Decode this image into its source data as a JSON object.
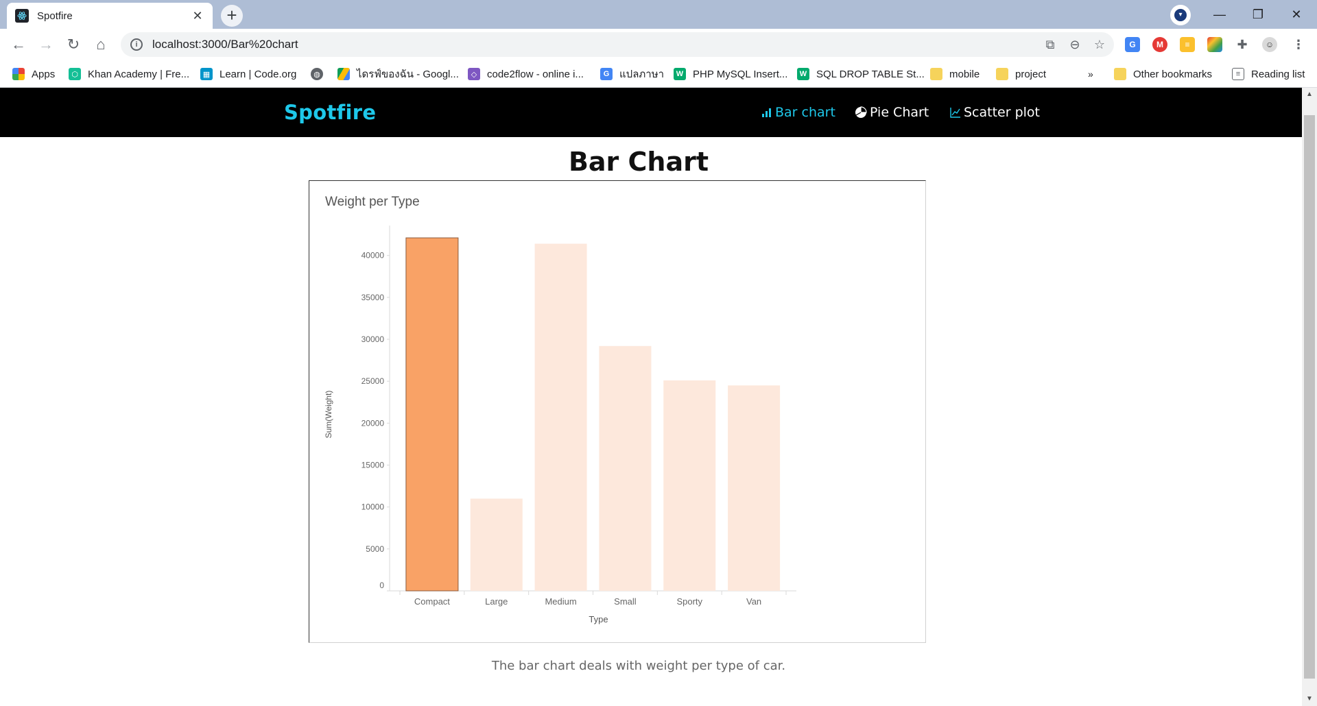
{
  "browser": {
    "tab_title": "Spotfire",
    "url": "localhost:3000/Bar%20chart",
    "bookmarks": [
      {
        "label": "Apps"
      },
      {
        "label": "Khan Academy | Fre..."
      },
      {
        "label": "Learn | Code.org"
      },
      {
        "label": ""
      },
      {
        "label": "ไดรฟ์ของฉัน - Googl..."
      },
      {
        "label": "code2flow - online i..."
      },
      {
        "label": "แปลภาษา"
      },
      {
        "label": "PHP MySQL Insert..."
      },
      {
        "label": "SQL DROP TABLE St..."
      },
      {
        "label": "mobile"
      },
      {
        "label": "project"
      }
    ],
    "overflow": "»",
    "other_bookmarks": "Other bookmarks",
    "reading_list": "Reading list"
  },
  "app": {
    "brand": "Spotfire",
    "nav": [
      {
        "label": "Bar chart",
        "active": true
      },
      {
        "label": "Pie Chart",
        "active": false
      },
      {
        "label": "Scatter plot",
        "active": false
      }
    ],
    "page_title": "Bar Chart",
    "caption": "The bar chart deals with weight per type of car."
  },
  "colors": {
    "brand": "#1ec8ea",
    "bar_selected": "#f9a266",
    "bar_other": "#fde8dc",
    "nav_bg": "#000000"
  },
  "chart_data": {
    "type": "bar",
    "title": "Weight per Type",
    "xlabel": "Type",
    "ylabel": "Sum(Weight)",
    "categories": [
      "Compact",
      "Large",
      "Medium",
      "Small",
      "Sporty",
      "Van"
    ],
    "values": [
      42100,
      11000,
      41400,
      29200,
      25100,
      24500
    ],
    "highlighted": [
      "Compact"
    ],
    "ylim": [
      0,
      42100
    ],
    "yticks": [
      0,
      5000,
      10000,
      15000,
      20000,
      25000,
      30000,
      35000,
      40000
    ],
    "grid": false
  }
}
